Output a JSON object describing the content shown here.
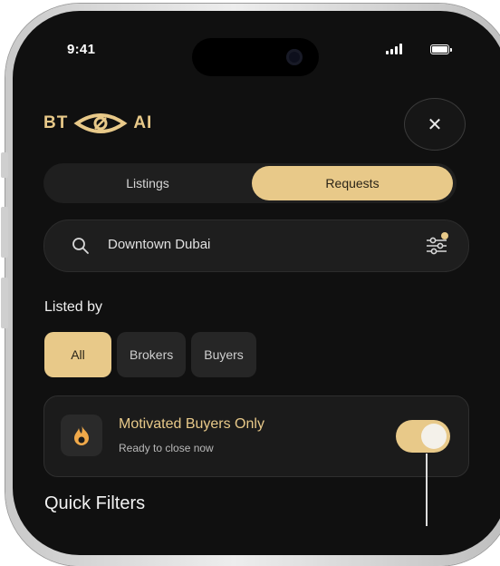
{
  "status_bar": {
    "time": "9:41"
  },
  "logo": {
    "left_text": "BT",
    "right_text": "AI"
  },
  "close_button": {
    "label": "✕"
  },
  "tabs": [
    {
      "label": "Listings",
      "active": false
    },
    {
      "label": "Requests",
      "active": true
    }
  ],
  "search": {
    "value": "Downtown Dubai"
  },
  "listed_by": {
    "label": "Listed by",
    "chips": [
      {
        "label": "All",
        "selected": true
      },
      {
        "label": "Brokers",
        "selected": false
      },
      {
        "label": "Buyers",
        "selected": false
      }
    ]
  },
  "motivated_card": {
    "title": "Motivated Buyers Only",
    "subtitle": "Ready to close now",
    "toggle_on": true
  },
  "quick_filters": {
    "label": "Quick Filters"
  },
  "colors": {
    "accent": "#e8c989",
    "background": "#101010",
    "surface": "#1e1e1e"
  }
}
